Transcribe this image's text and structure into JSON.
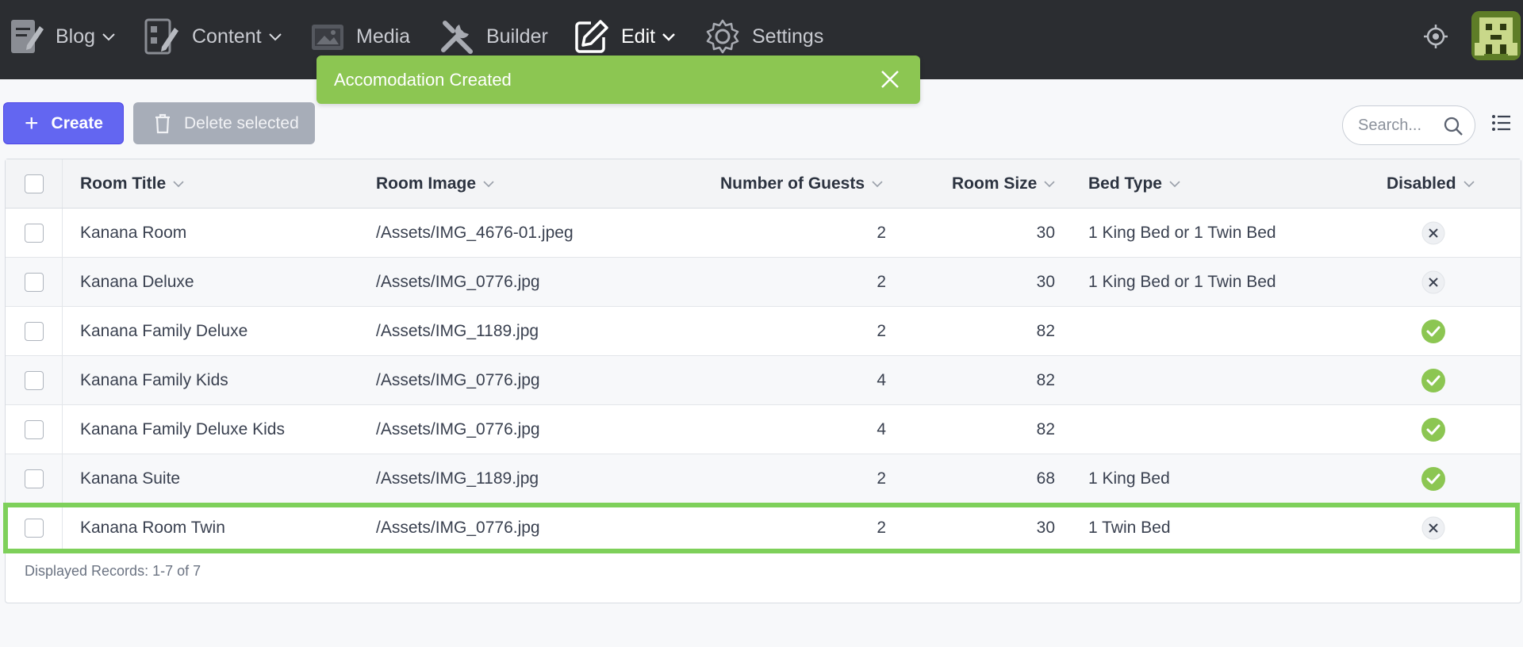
{
  "nav": {
    "items": [
      {
        "label": "Blog",
        "icon": "blog-icon"
      },
      {
        "label": "Content",
        "icon": "content-icon"
      },
      {
        "label": "Media",
        "icon": "media-icon"
      },
      {
        "label": "Builder",
        "icon": "builder-icon"
      },
      {
        "label": "Edit",
        "icon": "edit-icon"
      },
      {
        "label": "Settings",
        "icon": "settings-icon"
      }
    ]
  },
  "toast": {
    "message": "Accomodation Created"
  },
  "toolbar": {
    "create_label": "Create",
    "delete_label": "Delete selected",
    "search_placeholder": "Search..."
  },
  "table": {
    "columns": [
      "Room Title",
      "Room Image",
      "Number of Guests",
      "Room Size",
      "Bed Type",
      "Disabled"
    ],
    "rows": [
      {
        "title": "Kanana Room",
        "image": "/Assets/IMG_4676-01.jpeg",
        "guests": "2",
        "size": "30",
        "bed": "1 King Bed or 1 Twin Bed",
        "disabled": false
      },
      {
        "title": "Kanana Deluxe",
        "image": "/Assets/IMG_0776.jpg",
        "guests": "2",
        "size": "30",
        "bed": "1 King Bed or 1 Twin Bed",
        "disabled": false
      },
      {
        "title": "Kanana Family Deluxe",
        "image": "/Assets/IMG_1189.jpg",
        "guests": "2",
        "size": "82",
        "bed": "",
        "disabled": true
      },
      {
        "title": "Kanana Family Kids",
        "image": "/Assets/IMG_0776.jpg",
        "guests": "4",
        "size": "82",
        "bed": "",
        "disabled": true
      },
      {
        "title": "Kanana Family Deluxe Kids",
        "image": "/Assets/IMG_0776.jpg",
        "guests": "4",
        "size": "82",
        "bed": "",
        "disabled": true
      },
      {
        "title": "Kanana Suite",
        "image": "/Assets/IMG_1189.jpg",
        "guests": "2",
        "size": "68",
        "bed": "1 King Bed",
        "disabled": true
      },
      {
        "title": "Kanana Room Twin",
        "image": "/Assets/IMG_0776.jpg",
        "guests": "2",
        "size": "30",
        "bed": "1 Twin Bed",
        "disabled": false
      }
    ],
    "footer": "Displayed Records: 1-7 of 7"
  },
  "colors": {
    "topbar": "#2b2d31",
    "toast": "#8cc652",
    "primary": "#6366f1",
    "highlight": "#7ed05a",
    "check_green": "#8cc652"
  }
}
